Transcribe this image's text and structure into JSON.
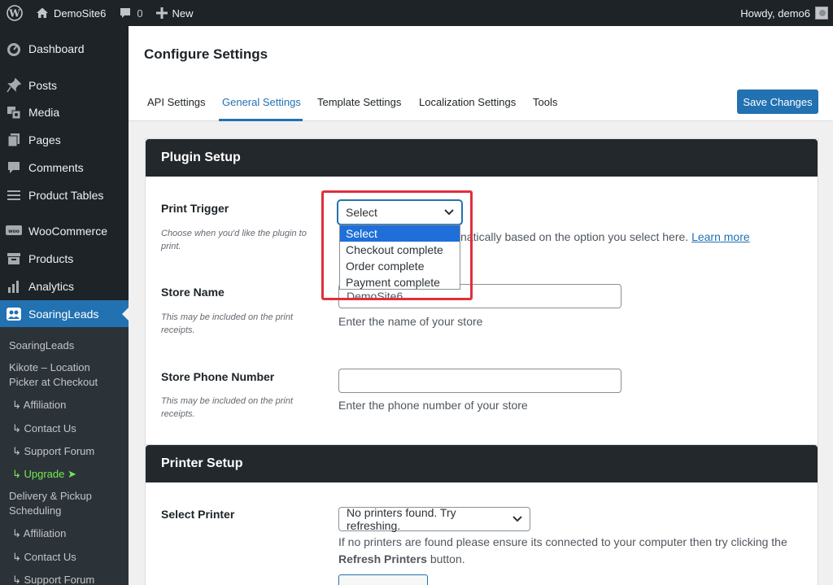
{
  "adminbar": {
    "site_name": "DemoSite6",
    "comment_count": "0",
    "new_label": "New",
    "howdy": "Howdy, demo6"
  },
  "sidebar": {
    "items": [
      {
        "label": "Dashboard",
        "icon": "dashboard-icon"
      },
      {
        "label": "Posts",
        "icon": "pin-icon"
      },
      {
        "label": "Media",
        "icon": "media-icon"
      },
      {
        "label": "Pages",
        "icon": "pages-icon"
      },
      {
        "label": "Comments",
        "icon": "comment-icon"
      },
      {
        "label": "Product Tables",
        "icon": "list-icon"
      },
      {
        "label": "WooCommerce",
        "icon": "woo-icon"
      },
      {
        "label": "Products",
        "icon": "archive-icon"
      },
      {
        "label": "Analytics",
        "icon": "bar-chart-icon"
      },
      {
        "label": "SoaringLeads",
        "icon": "people-icon"
      }
    ],
    "submenu": [
      {
        "label": "SoaringLeads"
      },
      {
        "label": "Kikote – Location Picker at Checkout"
      },
      {
        "label": "↳ Affiliation"
      },
      {
        "label": "↳ Contact Us"
      },
      {
        "label": "↳ Support Forum"
      },
      {
        "label": "↳ Upgrade ➤"
      },
      {
        "label": "Delivery & Pickup Scheduling"
      },
      {
        "label": "↳ Affiliation"
      },
      {
        "label": "↳ Contact Us"
      },
      {
        "label": "↳ Support Forum"
      }
    ]
  },
  "page": {
    "title": "Configure Settings",
    "tabs": [
      "API Settings",
      "General Settings",
      "Template Settings",
      "Localization Settings",
      "Tools"
    ],
    "save_label": "Save Changes"
  },
  "plugin_setup": {
    "heading": "Plugin Setup",
    "print_trigger": {
      "label": "Print Trigger",
      "desc": "Choose when you'd like the plugin to print.",
      "selected": "Select",
      "options": [
        "Select",
        "Checkout complete",
        "Order complete",
        "Payment complete"
      ],
      "help": "natically based on the option you select here.",
      "learn_more": "Learn more"
    },
    "store_name": {
      "label": "Store Name",
      "desc": "This may be included on the print receipts.",
      "value": "DemoSite6",
      "help": "Enter the name of your store"
    },
    "store_phone": {
      "label": "Store Phone Number",
      "desc": "This may be included on the print receipts.",
      "value": "",
      "help": "Enter the phone number of your store"
    }
  },
  "printer_setup": {
    "heading": "Printer Setup",
    "select_printer": {
      "label": "Select Printer",
      "value": "No printers found. Try refreshing.",
      "help_1": "If no printers are found please ensure its connected to your computer then try clicking the",
      "help_bold": "Refresh Printers",
      "help_2": "button."
    }
  },
  "colors": {
    "admin_dark": "#1d2327",
    "accent": "#2271b1",
    "highlight": "#e0303b",
    "upgrade": "#72ea4f"
  }
}
